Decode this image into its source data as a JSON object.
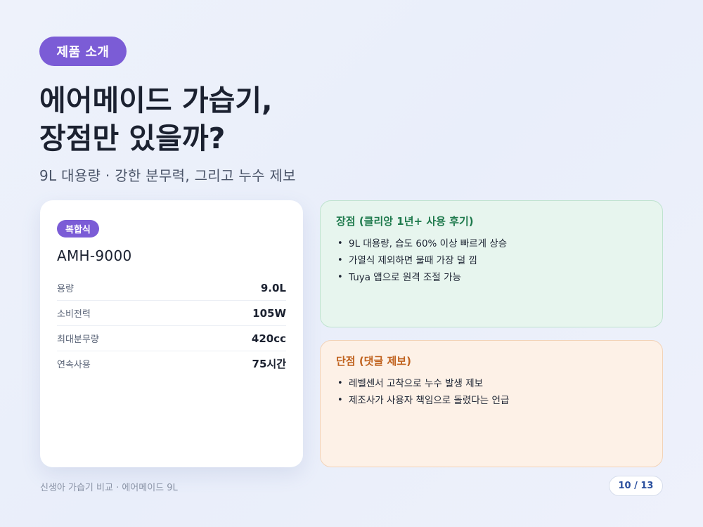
{
  "header": {
    "tag": "제품 소개",
    "title_line1": "에어메이드 가습기,",
    "title_line2": "장점만 있을까?",
    "subtitle": "9L 대용량 · 강한 분무력, 그리고 누수 제보"
  },
  "spec_card": {
    "type_badge": "복합식",
    "model": "AMH-9000",
    "rows": [
      {
        "label": "용량",
        "value": "9.0L"
      },
      {
        "label": "소비전력",
        "value": "105W"
      },
      {
        "label": "최대분무량",
        "value": "420cc"
      },
      {
        "label": "연속사용",
        "value": "75시간"
      }
    ]
  },
  "pros": {
    "title": "장점 (클리앙 1년+ 사용 후기)",
    "items": [
      "9L 대용량, 습도 60% 이상 빠르게 상승",
      "가열식 제외하면 물때 가장 덜 낌",
      "Tuya 앱으로 원격 조절 가능"
    ]
  },
  "cons": {
    "title": "단점 (댓글 제보)",
    "items": [
      "레벨센서 고착으로 누수 발생 제보",
      "제조사가 사용자 책임으로 돌렸다는 언급"
    ]
  },
  "footer": {
    "text": "신생아 가습기 비교 · 에어메이드 9L",
    "page": "10 / 13"
  },
  "colors": {
    "accent_purple": "#7b5cd6",
    "pros_green": "#1f7a4d",
    "cons_orange": "#c0621e",
    "page_blue": "#2a4f9e"
  }
}
